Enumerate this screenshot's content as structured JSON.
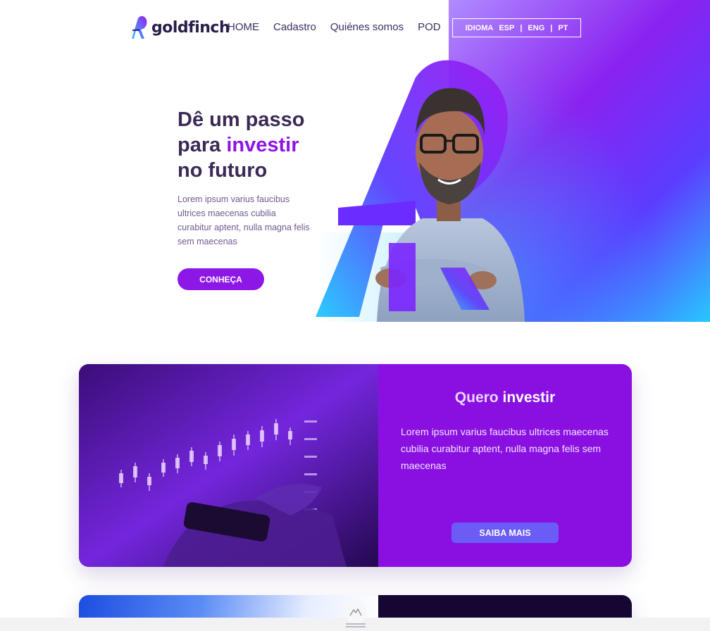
{
  "brand": {
    "name": "goldfinch"
  },
  "nav": {
    "items": [
      {
        "label": "HOME"
      },
      {
        "label": "Cadastro"
      },
      {
        "label": "Quiénes somos"
      },
      {
        "label": "POD"
      }
    ],
    "language": {
      "label": "IDIOMA",
      "options": [
        "ESP",
        "ENG",
        "PT"
      ],
      "separator": "|"
    }
  },
  "hero": {
    "title_line1": "Dê um passo",
    "title_line2_prefix": "para ",
    "title_line2_accent": "investir",
    "title_line3": "no futuro",
    "text": "Lorem ipsum varius faucibus ultrices maecenas cubilia curabitur aptent, nulla magna felis sem maecenas",
    "cta_label": "CONHEÇA"
  },
  "card1": {
    "title_prefix": "Quero",
    "title_accent": "investir",
    "text": "Lorem ipsum varius faucibus ultrices maecenas cubilia curabitur aptent, nulla magna felis sem maecenas",
    "cta_label": "SAIBA MAIS"
  },
  "colors": {
    "accent_purple": "#8d17e6",
    "card_panel": "#8a10e2",
    "button_indigo": "#6a5cf5",
    "dark_panel": "#160634",
    "text_dark": "#3a2a55"
  }
}
